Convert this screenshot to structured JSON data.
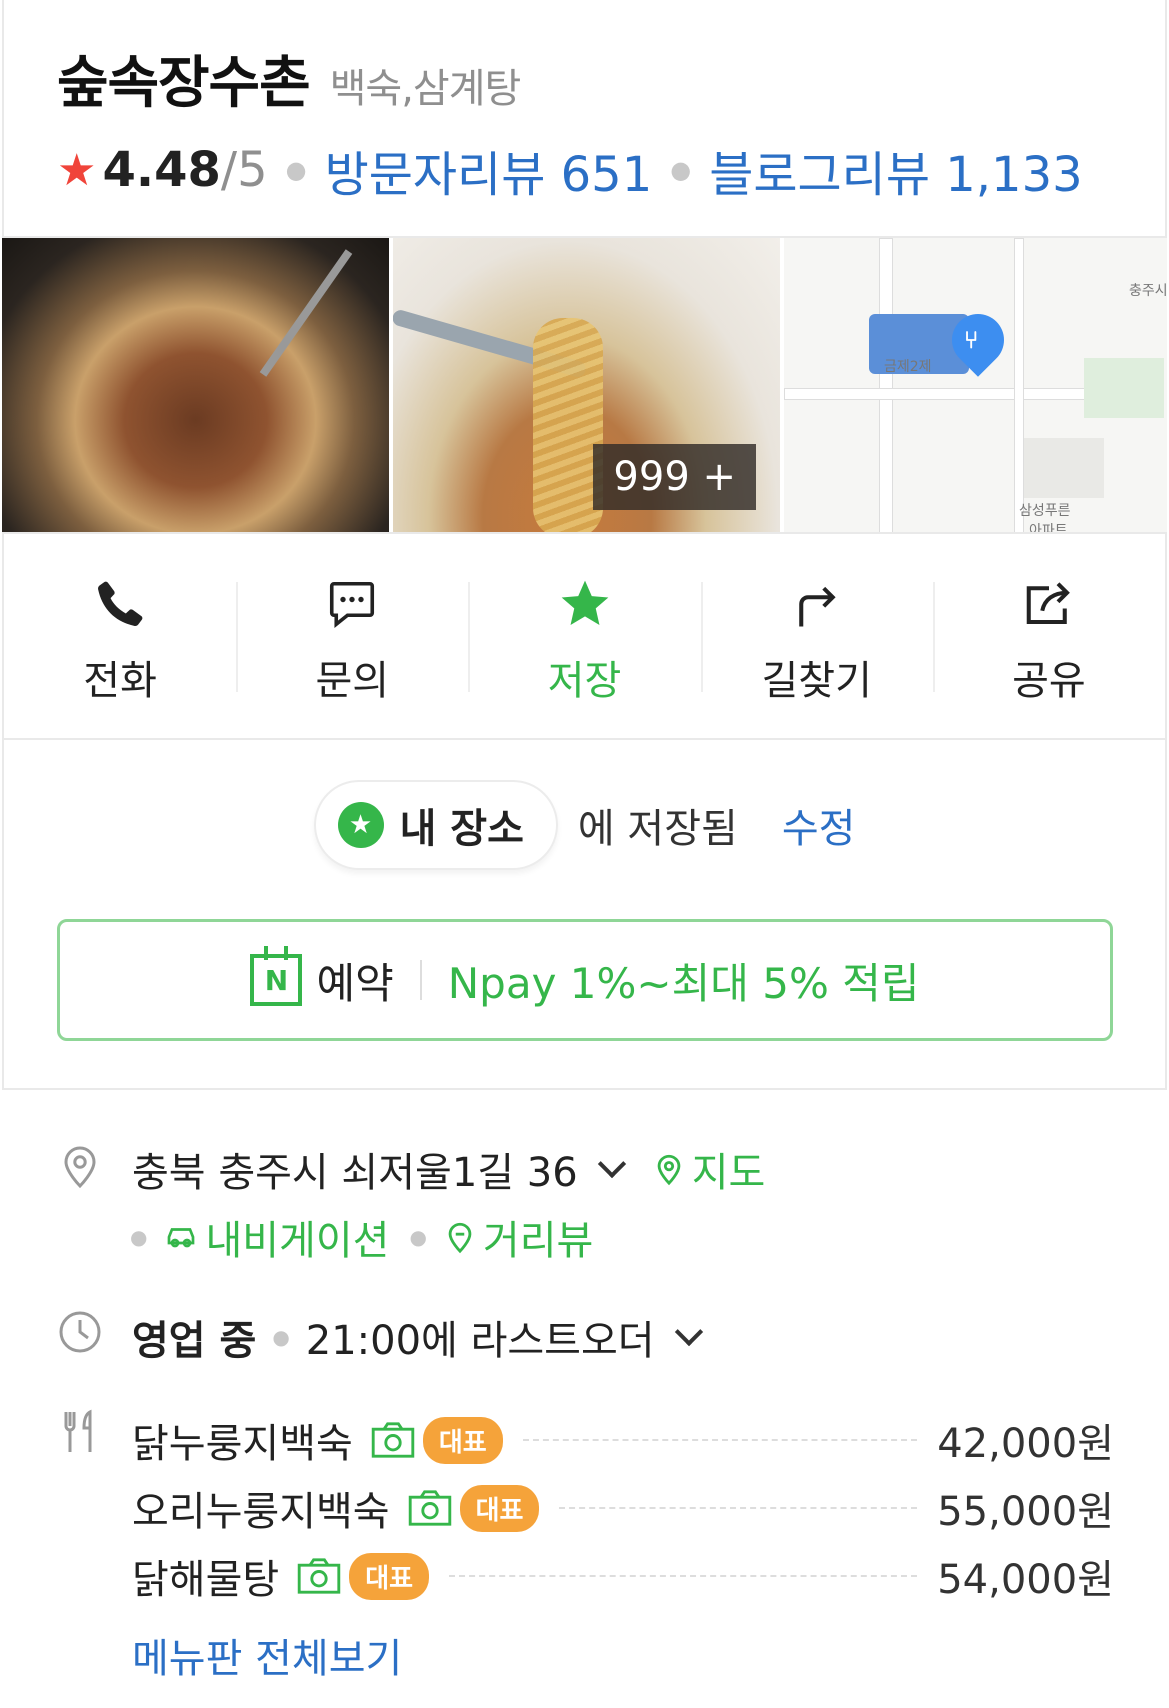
{
  "place": {
    "name": "숲속장수촌",
    "category": "백숙,삼계탕",
    "rating": "4.48",
    "rating_max": "/5",
    "visitor_reviews": "방문자리뷰 651",
    "blog_reviews": "블로그리뷰 1,133"
  },
  "photos": {
    "count_badge": "999 +",
    "map_labels": [
      "충주시",
      "금제2제",
      "삼성푸른",
      "아파트"
    ]
  },
  "actions": [
    {
      "label": "전화",
      "icon": "phone-icon"
    },
    {
      "label": "문의",
      "icon": "chat-icon"
    },
    {
      "label": "저장",
      "icon": "star-icon"
    },
    {
      "label": "길찾기",
      "icon": "directions-icon"
    },
    {
      "label": "공유",
      "icon": "share-icon"
    }
  ],
  "saved": {
    "list_name": "내 장소",
    "status_text": "에 저장됨",
    "edit_label": "수정"
  },
  "booking": {
    "label": "예약",
    "promo": "Npay 1%~최대 5% 적립"
  },
  "address": {
    "text": "충북 충주시 쇠저울1길 36",
    "map_link": "지도",
    "navigation_link": "내비게이션",
    "streetview_link": "거리뷰"
  },
  "hours": {
    "status": "영업 중",
    "last_order": "21:00에 라스트오더"
  },
  "menu": {
    "items": [
      {
        "name": "닭누룽지백숙",
        "badge": "대표",
        "price": "42,000원"
      },
      {
        "name": "오리누룽지백숙",
        "badge": "대표",
        "price": "55,000원"
      },
      {
        "name": "닭해물탕",
        "badge": "대표",
        "price": "54,000원"
      }
    ],
    "view_all": "메뉴판 전체보기"
  },
  "colors": {
    "accent_green": "#35b64a",
    "link_blue": "#2b6fc5",
    "star_red": "#f0443a",
    "badge_orange": "#f5a33a"
  }
}
